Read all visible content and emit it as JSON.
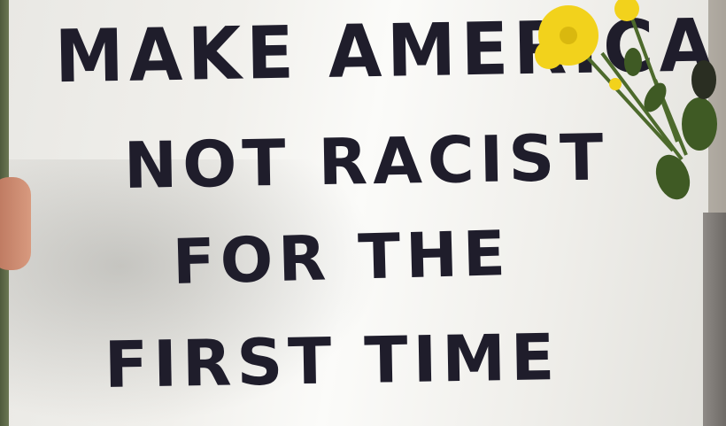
{
  "sign": {
    "lines": [
      "MAKE AMERICA",
      "NOT RACIST",
      "FOR THE",
      "FIRST TIME"
    ]
  },
  "colors": {
    "ink": "#1f1d2b",
    "paper": "#f1f0ec",
    "flower": "#f2d21c"
  }
}
